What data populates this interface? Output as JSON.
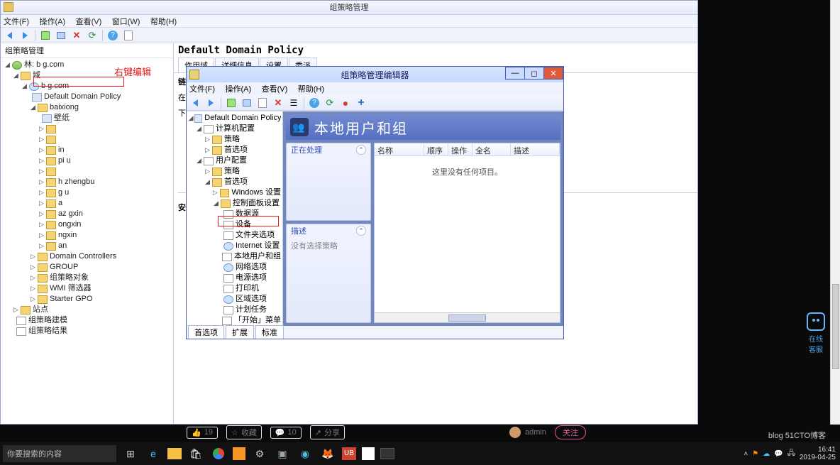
{
  "app": {
    "title": "组策略管理"
  },
  "menus": {
    "file": "文件(F)",
    "action": "操作(A)",
    "view": "查看(V)",
    "window": "窗口(W)",
    "help": "帮助(H)"
  },
  "tree": {
    "root": "组策略管理",
    "forest": "林: b            g.com",
    "domains": "域",
    "domain": "b            g.com",
    "ddp": "Default Domain Policy",
    "baixiong": "baixiong",
    "items": [
      "壁纸",
      "",
      "",
      "            in",
      "pi            u",
      "",
      "h     zhengbu",
      "g          u",
      "           a",
      "az       gxin",
      "         ongxin",
      "             ngxin",
      "            an"
    ],
    "dc": "Domain Controllers",
    "group": "GROUP",
    "gpo_obj": "组策略对象",
    "wmi": "WMI 筛选器",
    "starter": "Starter GPO",
    "sites": "站点",
    "modeling": "组策略建模",
    "results": "组策略结果",
    "annotation": "右键编辑"
  },
  "right": {
    "header": "Default Domain Policy",
    "tabs": [
      "作用域",
      "详细信息",
      "设置",
      "委派"
    ],
    "section": "链接",
    "line1": "在",
    "line2": "下",
    "line3": "安"
  },
  "editor": {
    "title": "组策略管理编辑器",
    "menus": {
      "file": "文件(F)",
      "action": "操作(A)",
      "view": "查看(V)",
      "help": "帮助(H)"
    },
    "root": "Default Domain Policy [DC.B/",
    "computer_cfg": "计算机配置",
    "policies": "策略",
    "prefs": "首选项",
    "user_cfg": "用户配置",
    "win_settings": "Windows 设置",
    "cp_settings": "控制面板设置",
    "cp_items": [
      "数据源",
      "设备",
      "文件夹选项",
      "Internet 设置",
      "本地用户和组",
      "网络选项",
      "电源选项",
      "打印机",
      "区域选项",
      "计划任务",
      "「开始」菜单"
    ],
    "banner": "本地用户和组",
    "panel1": "正在处理",
    "panel2": "描述",
    "panel2_body": "没有选择策略",
    "cols": {
      "name": "名称",
      "order": "顺序",
      "op": "操作",
      "fullname": "全名",
      "desc": "描述"
    },
    "empty": "这里没有任何项目。",
    "bottom_tabs": [
      "首选项",
      "扩展",
      "标准"
    ]
  },
  "social": {
    "thumbs": "19",
    "star": "收藏",
    "comments": "10",
    "share": "分享",
    "user": "admin",
    "follow": "关注"
  },
  "cs": "在线\n客服",
  "taskbar": {
    "search": "你要搜索的内容",
    "time": "16:41",
    "date": "2019-04-25"
  },
  "watermark": "blog        51CTO博客"
}
